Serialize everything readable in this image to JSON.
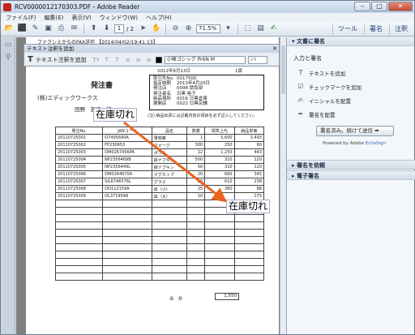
{
  "window": {
    "title": "RCV0000012170303.PDF - Adobe Reader",
    "btn_min": "–",
    "btn_max": "□",
    "btn_close": "✕"
  },
  "menu": [
    "ファイル(F)",
    "編集(E)",
    "表示(V)",
    "ウィンドウ(W)",
    "ヘルプ(H)"
  ],
  "toolbar": {
    "page_current": "1",
    "page_total": "/ 2",
    "zoom": "71.5%",
    "tab_tools": "ツール",
    "tab_sign": "署名",
    "tab_comment": "注釈"
  },
  "fax_header": "ファクシミからのFAX送信 【2014/04/02/19:41:13】",
  "comment_toolbar": {
    "title": "テキスト注釈を追加",
    "add_label": "テキスト注釈を追加",
    "font_name": "小塚ゴシック Pr6N M",
    "font_size": "24"
  },
  "invoice": {
    "title": "発注書",
    "company": "(株)エディックワークス",
    "person": "田野　友子　様",
    "date": "2012年6月13日",
    "page_no": "1頁",
    "info": [
      {
        "label": "取引先No.",
        "value": "0017500"
      },
      {
        "label": "指定納期",
        "value": "2013年4月20日"
      },
      {
        "label": "発注店",
        "value": "0098 請負部"
      },
      {
        "label": "発注者名",
        "value": "日黒 裕子"
      },
      {
        "label": "納品場所",
        "value": "0016 日黒倉庫"
      },
      {
        "label": "展開店",
        "value": "0022 日黒店舗"
      }
    ],
    "note": "(注) 納品伝票には記載内容の項目を必ず記入してください。",
    "headers": [
      "発注No.",
      "JANコード",
      "品名",
      "数量",
      "標準上代",
      "納品単価"
    ],
    "rows": [
      [
        "20110725001",
        "O7405690A",
        "果物庫",
        "1",
        "5,600",
        "3,493"
      ],
      [
        "20110725002",
        "FP230653",
        "フォーク",
        "300",
        "250",
        "60"
      ],
      [
        "20110725003",
        "OM0267456PA",
        "ボウル",
        "12",
        "1,250",
        "443"
      ],
      [
        "20110725004",
        "NP2356469B",
        "鉢ナプキン",
        "500",
        "310",
        "120"
      ],
      [
        "20110725005",
        "NP2356449L",
        "鉢ナプキン",
        "50",
        "310",
        "120"
      ],
      [
        "20110725006",
        "OM0264670A",
        "マグカップ",
        "20",
        "660",
        "345"
      ],
      [
        "20110725007",
        "SIL6746576L",
        "グラス",
        "20",
        "610",
        "238"
      ],
      [
        "20110725008",
        "OO112159A",
        "皿（小）",
        "25",
        "360",
        "88"
      ],
      [
        "20110725009",
        "OL3719548",
        "皿（大）",
        "10",
        "",
        "275"
      ],
      [
        "",
        "",
        "",
        "",
        "",
        ""
      ],
      [
        "",
        "",
        "",
        "",
        "",
        ""
      ],
      [
        "",
        "",
        "",
        "",
        "",
        ""
      ],
      [
        "",
        "",
        "",
        "",
        "",
        ""
      ],
      [
        "",
        "",
        "",
        "",
        "",
        ""
      ],
      [
        "",
        "",
        "",
        "",
        "",
        ""
      ],
      [
        "",
        "",
        "",
        "",
        "",
        ""
      ],
      [
        "",
        "",
        "",
        "",
        "",
        ""
      ],
      [
        "",
        "",
        "",
        "",
        "",
        ""
      ],
      [
        "",
        "",
        "",
        "",
        "",
        ""
      ],
      [
        "",
        "",
        "",
        "",
        "",
        ""
      ]
    ],
    "total_label": "合　計",
    "total_value": "1,550"
  },
  "stamps": {
    "stamp1": "在庫切れ",
    "stamp2": "在庫切れ"
  },
  "colors": {
    "arrow": "#e8641e"
  },
  "right_pane": {
    "section_sign": "文書に署名",
    "sub_title": "入力と署名",
    "items": [
      {
        "icon": "text-icon",
        "label": "テキストを追加"
      },
      {
        "icon": "checkmark-icon",
        "label": "チェックマークを追加"
      },
      {
        "icon": "initials-icon",
        "label": "イニシャルを配置"
      },
      {
        "icon": "signature-icon",
        "label": "署名を配置"
      }
    ],
    "action_button": "署名済み。続けて送信",
    "powered_prefix": "Powered by Adobe ",
    "powered_brand": "EchoSign",
    "section_request": "署名を依頼",
    "section_esign": "電子署名"
  }
}
